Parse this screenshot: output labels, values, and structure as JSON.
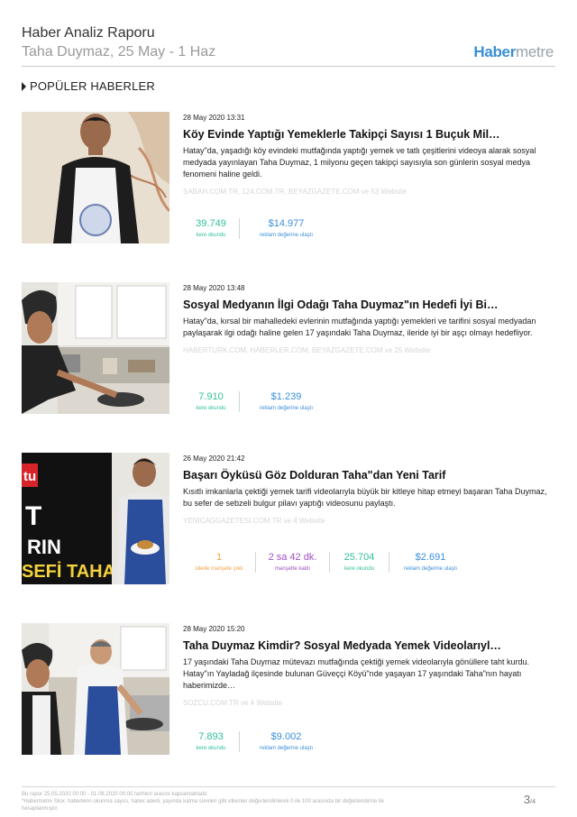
{
  "report": {
    "title": "Haber Analiz Raporu",
    "subtitle": "Taha Duymaz, 25 May - 1 Haz",
    "logo_bold": "Haber",
    "logo_light": "metre"
  },
  "section_title": "POPÜLER HABERLER",
  "colors": {
    "green": "#2fbf9a",
    "blue": "#3b8fd8",
    "orange": "#f0a14a",
    "purple": "#a04fbf"
  },
  "items": [
    {
      "date": "28 May 2020 13:31",
      "headline": "Köy Evinde Yaptığı Yemeklerle Takipçi Sayısı 1 Buçuk Mil…",
      "description": "Hatay\"da, yaşadığı köy evindeki mutfağında yaptığı yemek ve tatlı çeşitlerini videoya alarak sosyal medyada yayınlayan Taha Duymaz, 1 milyonu geçen takipçi sayısıyla son günlerin sosyal medya fenomeni haline geldi.",
      "sources": "SABAH.COM.TR, 124.COM.TR, BEYAZGAZETE.COM ve 53 Website",
      "stats": [
        {
          "value": "39.749",
          "label": "kere okundu"
        },
        {
          "value": "$14.977",
          "label": "reklam değerine ulaştı"
        }
      ]
    },
    {
      "date": "28 May 2020 13:48",
      "headline": "Sosyal Medyanın İlgi Odağı Taha Duymaz\"ın Hedefi İyi Bi…",
      "description": "Hatay\"da, kırsal bir mahalledeki evlerinin mutfağında yaptığı yemekleri ve tarifini sosyal medyadan paylaşarak ilgi odağı haline gelen 17 yaşındaki Taha Duymaz, ileride iyi bir aşçı olmayı hedefliyor.",
      "sources": "HABERTURK.COM, HABERLER.COM, BEYAZGAZETE.COM ve 25 Website",
      "stats": [
        {
          "value": "7.910",
          "label": "kere okundu"
        },
        {
          "value": "$1.239",
          "label": "reklam değerine ulaştı"
        }
      ]
    },
    {
      "date": "26 May 2020 21:42",
      "headline": "Başarı Öyküsü Göz Dolduran Taha\"dan Yeni Tarif",
      "description": "Kısıtlı imkanlarla çektiği yemek tarifi videolarıyla büyük bir kitleye hitap etmeyi başaran Taha Duymaz, bu sefer de sebzeli bulgur pilavı yaptığı videosunu paylaştı.",
      "sources": "YENICAGGAZETESI.COM.TR ve 4 Website",
      "thumb_text_1": "tu",
      "thumb_text_2": "T",
      "thumb_text_3": "RIN",
      "thumb_text_4": "SEFİ TAHA",
      "stats": [
        {
          "value": "1",
          "label": "sitede manşete çıktı"
        },
        {
          "value": "2 sa 42 dk.",
          "label": "manşette kaldı"
        },
        {
          "value": "25.704",
          "label": "kere okundu"
        },
        {
          "value": "$2.691",
          "label": "reklam değerine ulaştı"
        }
      ]
    },
    {
      "date": "28 May 2020 15:20",
      "headline": "Taha Duymaz Kimdir? Sosyal Medyada Yemek Videolarıyl…",
      "description": "17 yaşındaki Taha Duymaz mütevazı mutfağında çektiği yemek videolarıyla gönüllere taht kurdu. Hatay\"ın Yayladağ ilçesinde bulunan Güveççi Köyü\"nde yaşayan 17 yaşındaki Taha\"nın hayatı haberimizde…",
      "sources": "SOZCU.COM.TR ve 4 Website",
      "stats": [
        {
          "value": "7.893",
          "label": "kere okundu"
        },
        {
          "value": "$9.002",
          "label": "reklam değerine ulaştı"
        }
      ]
    }
  ],
  "footer": {
    "line1": "Bu rapor 25.05.2020 00:00 - 01.06.2020 00:00 tarihleri arasını kapsamaktadır.",
    "line2": "*Habermetre Skor, haberlerin okunma sayısı, haber adedi, yayında kalma süreleri gibi etkenler değerlendirilerek 0 ile 100 arasında bir değerlendirme ile hesaplanmıştır.",
    "page": "3",
    "total": "/4"
  }
}
